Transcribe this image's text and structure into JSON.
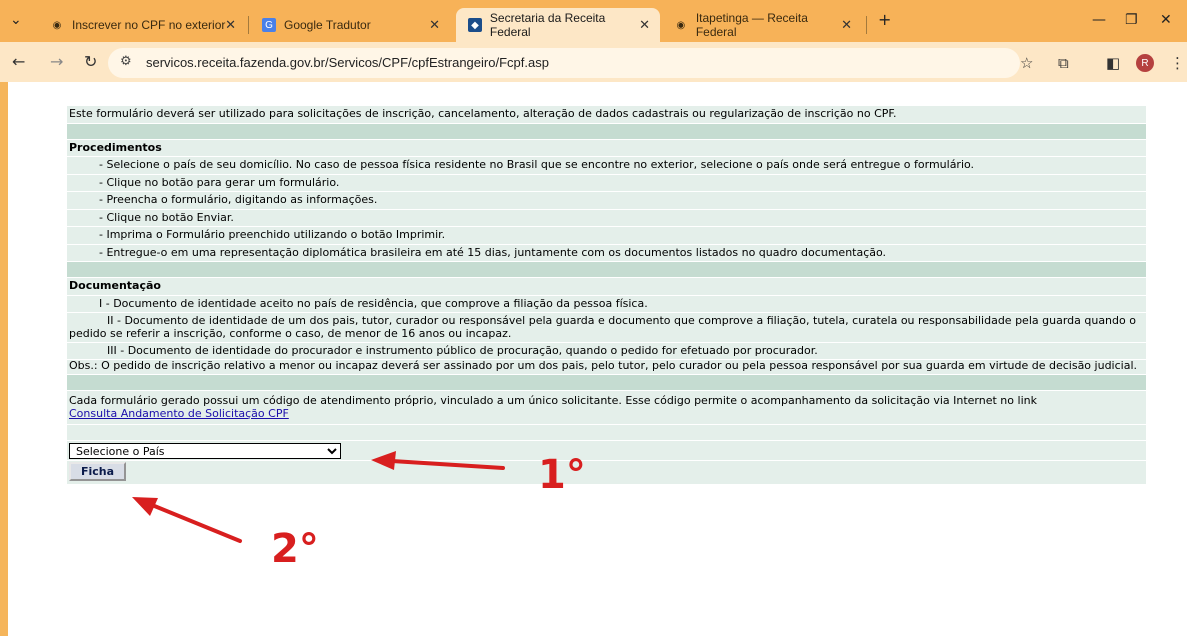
{
  "browser": {
    "tabs": [
      {
        "title": "Inscrever no CPF no exterior",
        "active": false
      },
      {
        "title": "Google Tradutor",
        "active": false
      },
      {
        "title": "Secretaria da Receita Federal",
        "active": true
      },
      {
        "title": "Itapetinga — Receita Federal",
        "active": false
      }
    ],
    "new_tab": "+",
    "url": "servicos.receita.fazenda.gov.br/Servicos/CPF/cpfEstrangeiro/Fcpf.asp",
    "avatar_initial": "R",
    "theme_color": "#f7b258"
  },
  "form": {
    "intro": "Este formulário deverá ser utilizado para solicitações de inscrição, cancelamento, alteração de dados cadastrais ou regularização de inscrição no CPF.",
    "procedimentos_title": "Procedimentos",
    "procedimentos": [
      "- Selecione o país de seu domicílio. No caso de pessoa física residente no Brasil que se encontre no exterior, selecione o país onde será entregue o formulário.",
      "- Clique no botão para gerar um formulário.",
      "- Preencha o formulário, digitando as informações.",
      "- Clique no botão Enviar.",
      "- Imprima o Formulário preenchido utilizando o botão Imprimir.",
      "- Entregue-o em uma representação diplomática brasileira em até 15 dias, juntamente com os documentos listados no quadro documentação."
    ],
    "documentacao_title": "Documentação",
    "doc_i": "I - Documento de identidade aceito no país de residência, que comprove a filiação da pessoa física.",
    "doc_ii": "II - Documento de identidade de um dos pais, tutor, curador ou responsável pela guarda e documento que comprove a filiação, tutela, curatela ou responsabilidade pela guarda quando o pedido se referir a inscrição, conforme o caso, de menor de 16 anos ou incapaz.",
    "doc_iii": "III - Documento de identidade do procurador e instrumento público de procuração, quando o pedido for efetuado por procurador.",
    "obs": "Obs.: O pedido de inscrição relativo a menor ou incapaz deverá ser assinado por um dos pais, pelo tutor, pelo curador ou pela pessoa responsável por sua guarda em virtude de decisão judicial.",
    "codigo_text": "Cada formulário gerado possui um código de atendimento próprio, vinculado a um único solicitante. Esse código permite o acompanhamento da solicitação via Internet no link",
    "consulta_link": "Consulta Andamento de Solicitação CPF",
    "country_select": "Selecione o País",
    "ficha_button": "Ficha"
  },
  "annotations": {
    "step1": "1°",
    "step2": "2°",
    "color": "#d81f1f"
  }
}
